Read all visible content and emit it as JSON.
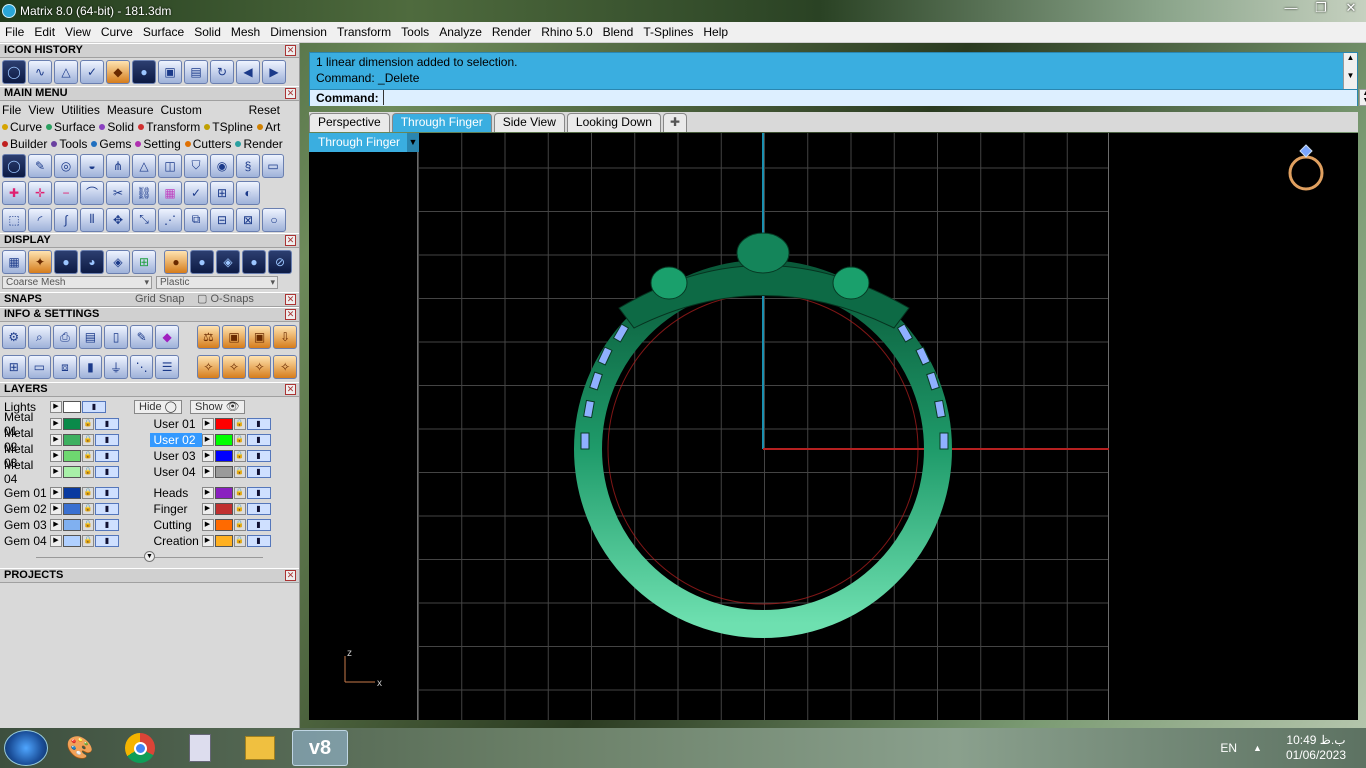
{
  "window": {
    "title": "Matrix 8.0 (64-bit) - 181.3dm"
  },
  "menubar": [
    "File",
    "Edit",
    "View",
    "Curve",
    "Surface",
    "Solid",
    "Mesh",
    "Dimension",
    "Transform",
    "Tools",
    "Analyze",
    "Render",
    "Rhino 5.0",
    "Blend",
    "T-Splines",
    "Help"
  ],
  "panels": {
    "icon_history": "ICON HISTORY",
    "main_menu": "MAIN MENU",
    "display": "DISPLAY",
    "snaps": "SNAPS",
    "info_settings": "INFO & SETTINGS",
    "layers": "LAYERS",
    "projects": "PROJECTS"
  },
  "main_menu": {
    "row1": [
      "File",
      "View",
      "Utilities",
      "Measure",
      "Custom"
    ],
    "reset": "Reset",
    "row2": [
      {
        "label": "Curve",
        "color": "#d6a400"
      },
      {
        "label": "Surface",
        "color": "#2aa060"
      },
      {
        "label": "Solid",
        "color": "#8a40c0"
      },
      {
        "label": "Transform",
        "color": "#d03030"
      },
      {
        "label": "TSpline",
        "color": "#c0a000"
      },
      {
        "label": "Art",
        "color": "#d08000"
      }
    ],
    "row3": [
      {
        "label": "Builder",
        "color": "#c02020"
      },
      {
        "label": "Tools",
        "color": "#6a40a0"
      },
      {
        "label": "Gems",
        "color": "#2070c0"
      },
      {
        "label": "Setting",
        "color": "#b030b0"
      },
      {
        "label": "Cutters",
        "color": "#e07000"
      },
      {
        "label": "Render",
        "color": "#2aa0a0"
      }
    ]
  },
  "display": {
    "mesh_option": "Coarse Mesh",
    "material_option": "Plastic"
  },
  "snaps": {
    "grid": "Grid Snap",
    "osnaps": "O-Snaps"
  },
  "layers": {
    "lights": "Lights",
    "hide": "Hide",
    "show": "Show",
    "left": [
      {
        "name": "Metal 01",
        "color": "#0a8a4a"
      },
      {
        "name": "Metal 02",
        "color": "#3cb060"
      },
      {
        "name": "Metal 03",
        "color": "#6ed870"
      },
      {
        "name": "Metal 04",
        "color": "#a8f0a8"
      },
      {
        "name": "Gem 01",
        "color": "#0a3aa0"
      },
      {
        "name": "Gem 02",
        "color": "#3a70d0"
      },
      {
        "name": "Gem 03",
        "color": "#80b0f0"
      },
      {
        "name": "Gem 04",
        "color": "#b0d0ff"
      }
    ],
    "right": [
      {
        "name": "User 01",
        "color": "#ff0000"
      },
      {
        "name": "User 02",
        "color": "#00ff00",
        "selected": true
      },
      {
        "name": "User 03",
        "color": "#0000ff"
      },
      {
        "name": "User 04",
        "color": "#9a9a9a"
      },
      {
        "name": "Heads",
        "color": "#8a20c0"
      },
      {
        "name": "Finger",
        "color": "#c03030"
      },
      {
        "name": "Cutting",
        "color": "#ff6a00"
      },
      {
        "name": "Creation",
        "color": "#ffb020"
      }
    ]
  },
  "command": {
    "history": [
      "1 linear dimension added to selection.",
      "Command: _Delete"
    ],
    "prompt": "Command:",
    "value": ""
  },
  "tabs": [
    "Perspective",
    "Through Finger",
    "Side View",
    "Looking Down"
  ],
  "active_tab": "Through Finger",
  "viewport": {
    "label": "Through Finger",
    "axis_z": "z",
    "axis_x": "x"
  },
  "taskbar": {
    "lang": "EN",
    "time": "10:49 ب.ظ",
    "date": "01/06/2023",
    "active_app": "v8"
  }
}
